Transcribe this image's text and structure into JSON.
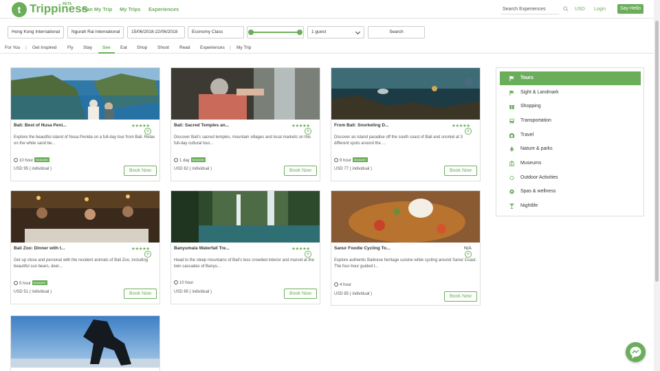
{
  "header": {
    "brand": "Trippiness",
    "beta": "BETA",
    "nav": [
      "Plan My Trip",
      "My Trips",
      "Experiences"
    ],
    "search_placeholder": "Search Experiences",
    "currency": "USD",
    "login": "Login",
    "hello": "Say Hello"
  },
  "search": {
    "from": "Hong Kong International",
    "to": "Ngurah Rai International",
    "dates": "15/06/2018-22/06/2018",
    "cabin": "Economy Class",
    "guests": "1 guest",
    "button": "Search"
  },
  "categories": [
    "For You",
    "Get Inspired",
    "Fly",
    "Stay",
    "See",
    "Eat",
    "Shop",
    "Shoot",
    "Read",
    "Experiences",
    "My Trip"
  ],
  "active_category": "See",
  "cards": [
    {
      "title": "Bali: Best of Nusa Peni...",
      "rating": "★★★★★",
      "desc": "Explore the beautiful island of Nusa Penida on a full-day tour from Bali. Relax on the white sand be...",
      "duration": "10 hour",
      "badge": "Bestseller",
      "price": "USD 95 ( individual )",
      "book": "Book Now"
    },
    {
      "title": "Bali: Sacred Temples an...",
      "rating": "★★★★★",
      "desc": "Discover Bali's sacred temples, mountain villages and local markets on this full-day cultural tour...",
      "duration": "1 day",
      "badge": "Bestseller",
      "price": "USD 62 ( individual )",
      "book": "Book Now"
    },
    {
      "title": "From Bali: Snorkeling D...",
      "rating": "★★★★★",
      "desc": "Discover an island paradise off the south coast of Bali and snorkel at 3 different spots around the ...",
      "duration": "9 hour",
      "badge": "Bestseller",
      "price": "USD 77 ( individual )",
      "book": "Book Now"
    },
    {
      "title": "Bali Zoo: Dinner with t...",
      "rating": "★★★★★",
      "desc": "Get up close and personal with the resident animals of Bali Zoo, including beautiful sun bears, deer...",
      "duration": "5 hour",
      "badge": "Bestseller",
      "price": "USD 51 ( individual )",
      "book": "Book Now"
    },
    {
      "title": "Banyumala Waterfall Tre...",
      "rating": "★★★★★",
      "desc": "Head to the steep mountains of Bali's less crowded interior and marvel at the twin cascades of Banyu...",
      "duration": "10 hour",
      "badge": "",
      "price": "USD 65 ( individual )",
      "book": "Book Now"
    },
    {
      "title": "Sanur Foodie Cycling To...",
      "rating": "N/A",
      "desc": "Explore authentic Balinese heritage cuisine while cycling around Sanur Coast. The four-hour guided t...",
      "duration": "4 hour",
      "badge": "",
      "price": "USD 85 ( individual )",
      "book": "Book Now"
    }
  ],
  "sidebar": [
    {
      "label": "Tours",
      "icon": "flag-icon"
    },
    {
      "label": "Sight & Landmark",
      "icon": "flag-icon"
    },
    {
      "label": "Shopping",
      "icon": "gift-icon"
    },
    {
      "label": "Transportation",
      "icon": "bus-icon"
    },
    {
      "label": "Travel",
      "icon": "camera-icon"
    },
    {
      "label": "Nature & parks",
      "icon": "tree-icon"
    },
    {
      "label": "Museums",
      "icon": "museum-icon"
    },
    {
      "label": "Outdoor Activities",
      "icon": "sun-icon"
    },
    {
      "label": "Spas & wellness",
      "icon": "leaf-icon"
    },
    {
      "label": "Nightlife",
      "icon": "cocktail-icon"
    }
  ],
  "colors": {
    "accent": "#6aae5a"
  }
}
